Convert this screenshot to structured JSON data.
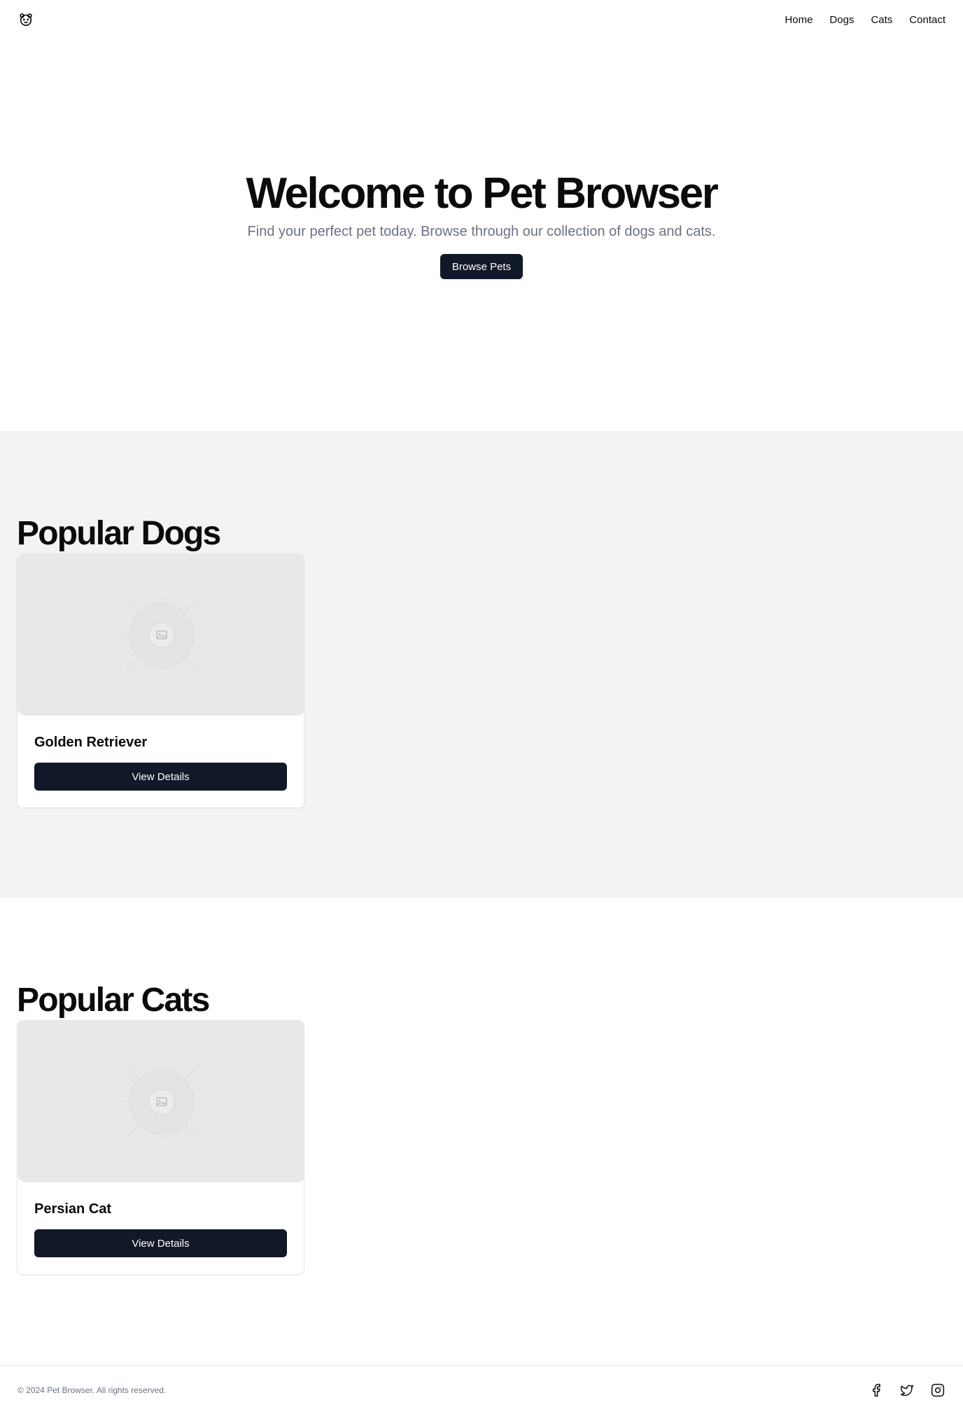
{
  "header": {
    "logo_icon": "bear-face-icon",
    "nav": [
      {
        "label": "Home"
      },
      {
        "label": "Dogs"
      },
      {
        "label": "Cats"
      },
      {
        "label": "Contact"
      }
    ]
  },
  "hero": {
    "title": "Welcome to Pet Browser",
    "subtitle": "Find your perfect pet today. Browse through our collection of dogs and cats.",
    "button_label": "Browse Pets"
  },
  "dogs_section": {
    "title": "Popular Dogs",
    "cards": [
      {
        "name": "Golden Retriever",
        "button_label": "View Details",
        "image_icon": "image-placeholder-icon"
      }
    ]
  },
  "cats_section": {
    "title": "Popular Cats",
    "cards": [
      {
        "name": "Persian Cat",
        "button_label": "View Details",
        "image_icon": "image-placeholder-icon"
      }
    ]
  },
  "footer": {
    "copyright": "© 2024 Pet Browser. All rights reserved.",
    "social": [
      "facebook-icon",
      "twitter-icon",
      "instagram-icon"
    ]
  },
  "colors": {
    "primary_button": "#111827",
    "section_bg": "#f2f3f5",
    "muted_text": "#6b7280"
  }
}
